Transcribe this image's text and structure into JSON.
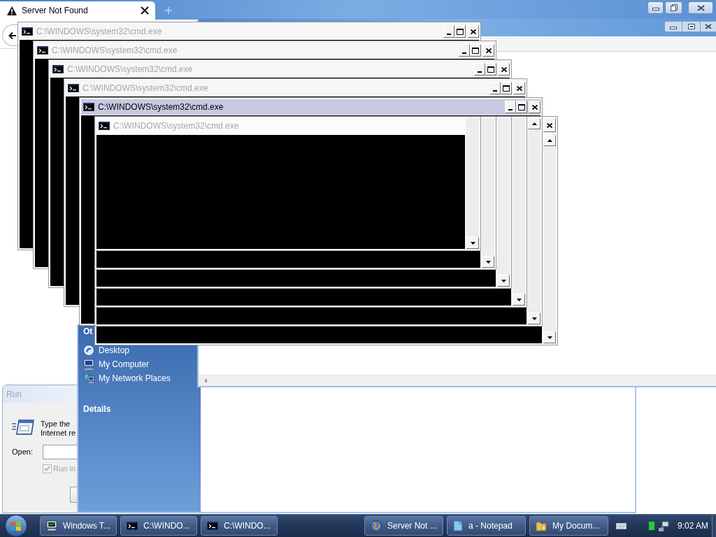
{
  "browser": {
    "tab": {
      "title": "Server Not Found"
    }
  },
  "cmd_windows": [
    {
      "kind": "window",
      "title": "C:\\WINDOWS\\system32\\cmd.exe",
      "active": false
    },
    {
      "kind": "window",
      "title": "C:\\WINDOWS\\system32\\cmd.exe",
      "active": false
    },
    {
      "kind": "window",
      "title": "C:\\WINDOWS\\system32\\cmd.exe",
      "active": false
    },
    {
      "kind": "window",
      "title": "C:\\WINDOWS\\system32\\cmd.exe",
      "active": false
    },
    {
      "kind": "window",
      "title": "C:\\WINDOWS\\system32\\cmd.exe",
      "active": true
    },
    {
      "kind": "ghost",
      "title": "C:\\WINDOWS\\system32\\cmd.exe",
      "active": false
    }
  ],
  "explorer": {
    "task_pane": [
      {
        "title": "Ot",
        "items": [
          {
            "label": "Desktop"
          },
          {
            "label": "My Computer"
          },
          {
            "label": "My Network Places"
          }
        ]
      },
      {
        "title": "Details"
      }
    ]
  },
  "run_dialog": {
    "title": "Run",
    "description": [
      "Type the",
      "Internet re"
    ],
    "open_label": "Open:",
    "option": {
      "label": "Run in",
      "checked": true,
      "disabled": true
    }
  },
  "taskbar": {
    "buttons": [
      {
        "label": "Windows T..."
      },
      {
        "label": "C:\\WINDO..."
      },
      {
        "label": "C:\\WINDO..."
      },
      {
        "label": "Server Not ..."
      },
      {
        "label": "a - Notepad"
      },
      {
        "label": "My Docum..."
      }
    ],
    "clock": "9:02 AM"
  }
}
